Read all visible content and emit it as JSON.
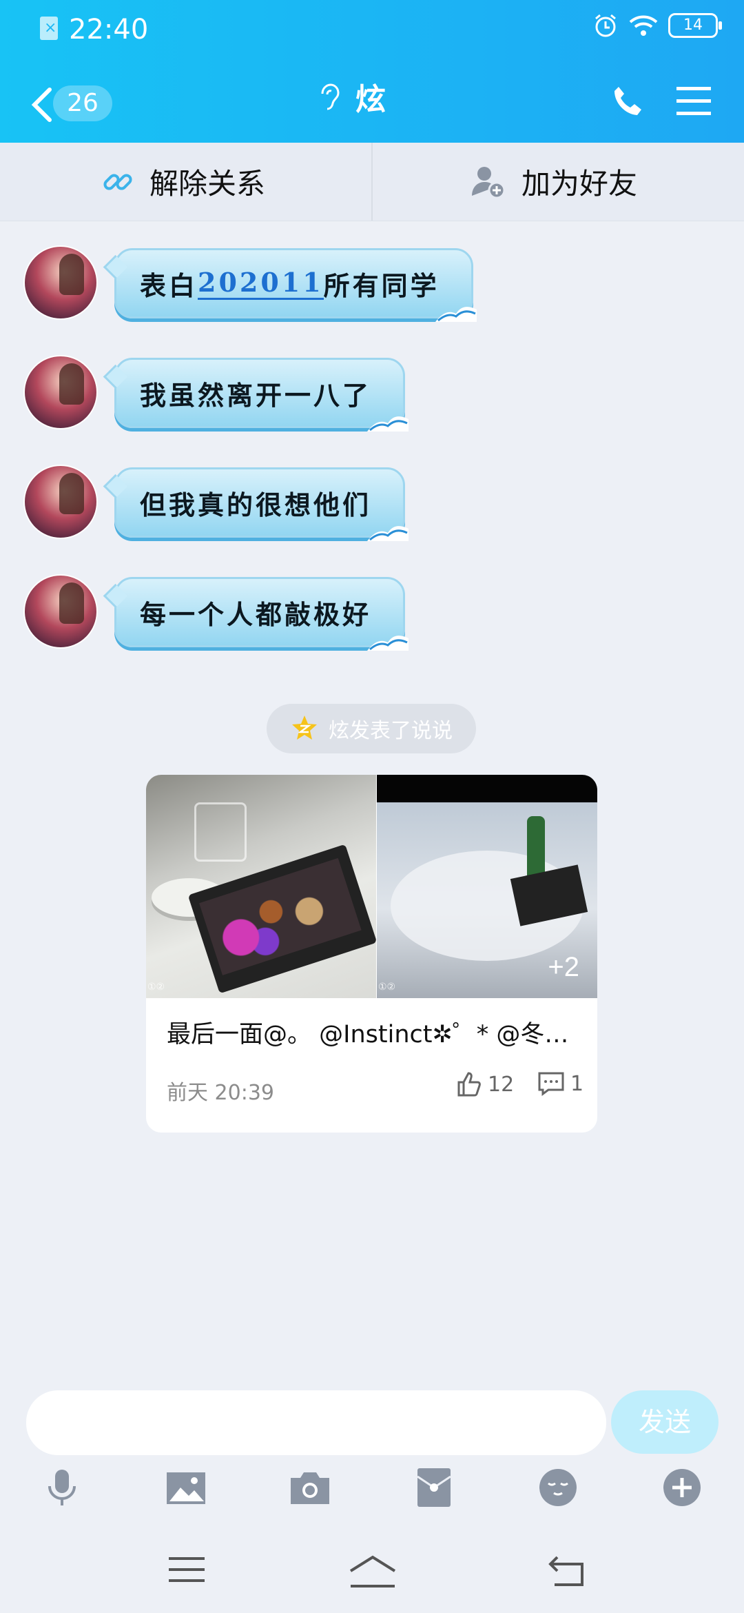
{
  "status_bar": {
    "time": "22:40",
    "sim_mark": "×",
    "battery": "14"
  },
  "header": {
    "back_count": "26",
    "title": "炫"
  },
  "action_bar": {
    "unbind_label": "解除关系",
    "add_friend_label": "加为好友"
  },
  "messages": [
    {
      "pre": "表白",
      "link": "202011",
      "post": "所有同学"
    },
    {
      "text": "我虽然离开一八了"
    },
    {
      "text": "但我真的很想他们"
    },
    {
      "text": "每一个人都敲极好"
    }
  ],
  "feed_notice": "炫发表了说说",
  "card": {
    "text": "最后一面@。 @Instinct✲゜* @冬…",
    "more_photos": "+2",
    "photo_tag": "①②",
    "time": "前天 20:39",
    "likes": "12",
    "comments": "1"
  },
  "composer": {
    "send_label": "发送",
    "placeholder": ""
  },
  "colors": {
    "header": "#1ea8f3",
    "bubble": "#b7e4f7",
    "send_disabled": "#bfeefc"
  },
  "icons": [
    "back-icon",
    "ear-icon",
    "phone-icon",
    "menu-icon",
    "link-icon",
    "add-friend-icon",
    "qzone-star-icon",
    "like-icon",
    "comment-icon",
    "mic-icon",
    "image-icon",
    "camera-icon",
    "redpacket-icon",
    "emoji-icon",
    "plus-icon",
    "nav-menu-icon",
    "nav-home-icon",
    "nav-back-icon"
  ]
}
